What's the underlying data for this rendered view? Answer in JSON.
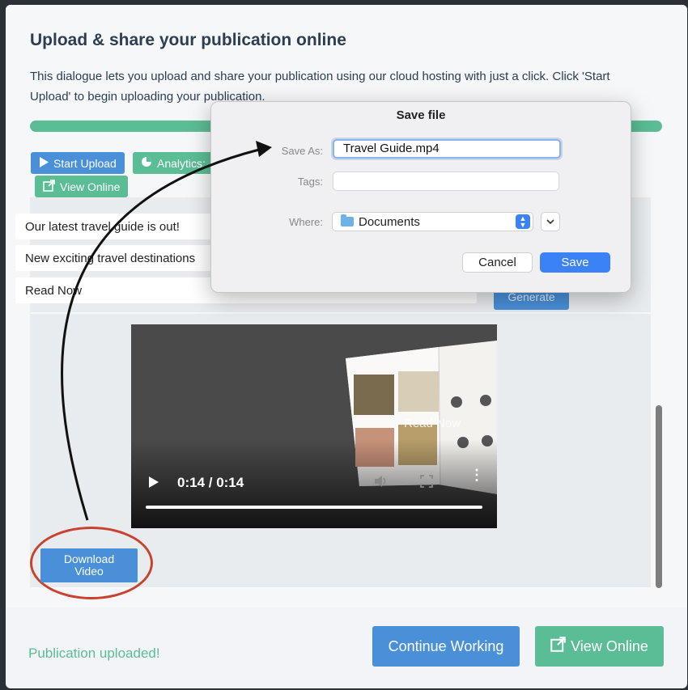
{
  "dialog": {
    "title": "Upload & share your publication online",
    "description": "This dialogue lets you upload and share your publication using our cloud hosting with just a click. Click 'Start Upload' to begin uploading your publication.",
    "progress_fraction": 1.0
  },
  "toolbar": {
    "start_upload_label": "Start Upload",
    "analytics_label": "Analytics:",
    "view_online_label": "View Online"
  },
  "share_panel": {
    "rows": [
      "Our latest travel guide is out!",
      "New exciting travel destinations",
      "Read Now"
    ],
    "generate_label": "Generate"
  },
  "video": {
    "time": "0:14 / 0:14",
    "overlay_text": "Read Now",
    "progress_fraction": 1.0
  },
  "download_button_label": "Download Video",
  "footer": {
    "status": "Publication uploaded!",
    "continue_label": "Continue Working",
    "view_online_label": "View Online"
  },
  "save_dialog": {
    "title": "Save file",
    "save_as_label": "Save As:",
    "save_as_value": "Travel Guide.mp4",
    "tags_label": "Tags:",
    "where_label": "Where:",
    "where_value": "Documents",
    "cancel_label": "Cancel",
    "save_label": "Save"
  },
  "colors": {
    "accent_blue": "#4a90d9",
    "accent_green": "#5bbd95",
    "annotation_red": "#c8432f",
    "mac_blue": "#3b82f6"
  }
}
